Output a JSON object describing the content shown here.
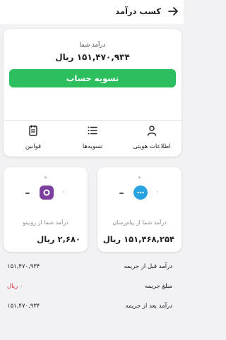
{
  "header": {
    "title": "کسب درآمد",
    "back_icon": "arrow-right-icon"
  },
  "summary": {
    "income_label": "درآمد شما",
    "income_value": "۱۵۱,۴۷۰,۹۳۴ ریال",
    "settle_button": "تسویه حساب"
  },
  "tabs": [
    {
      "label": "اطلاعات هویتی",
      "icon": "person-icon"
    },
    {
      "label": "تسویه‌ها",
      "icon": "list-icon"
    },
    {
      "label": "قوانین",
      "icon": "document-icon"
    }
  ],
  "cards": {
    "messenger": {
      "label": "درآمد شما از پیام‌رسان",
      "value": "۱۵۱,۴۶۸,۲۵۴ ریال",
      "icon": "chat-bubble-icon",
      "color": "#29a3e0"
    },
    "rubino": {
      "label": "درآمد شما از روبینو",
      "value": "۲,۶۸۰ ریال",
      "icon": "rubino-icon",
      "color": "#7b3fa0"
    }
  },
  "details": [
    {
      "label": "درآمد قبل از جریمه",
      "value": "۱۵۱,۴۷۰,۹۳۴",
      "color": "#222222"
    },
    {
      "label": "مبلغ جریمه",
      "value": "۰ ریال",
      "color": "#d32f2f"
    },
    {
      "label": "درآمد بعد از جریمه",
      "value": "۱۵۱,۴۷۰,۹۳۴",
      "color": "#222222"
    }
  ],
  "colors": {
    "accent": "#2dbf5e",
    "penalty": "#d32f2f"
  }
}
